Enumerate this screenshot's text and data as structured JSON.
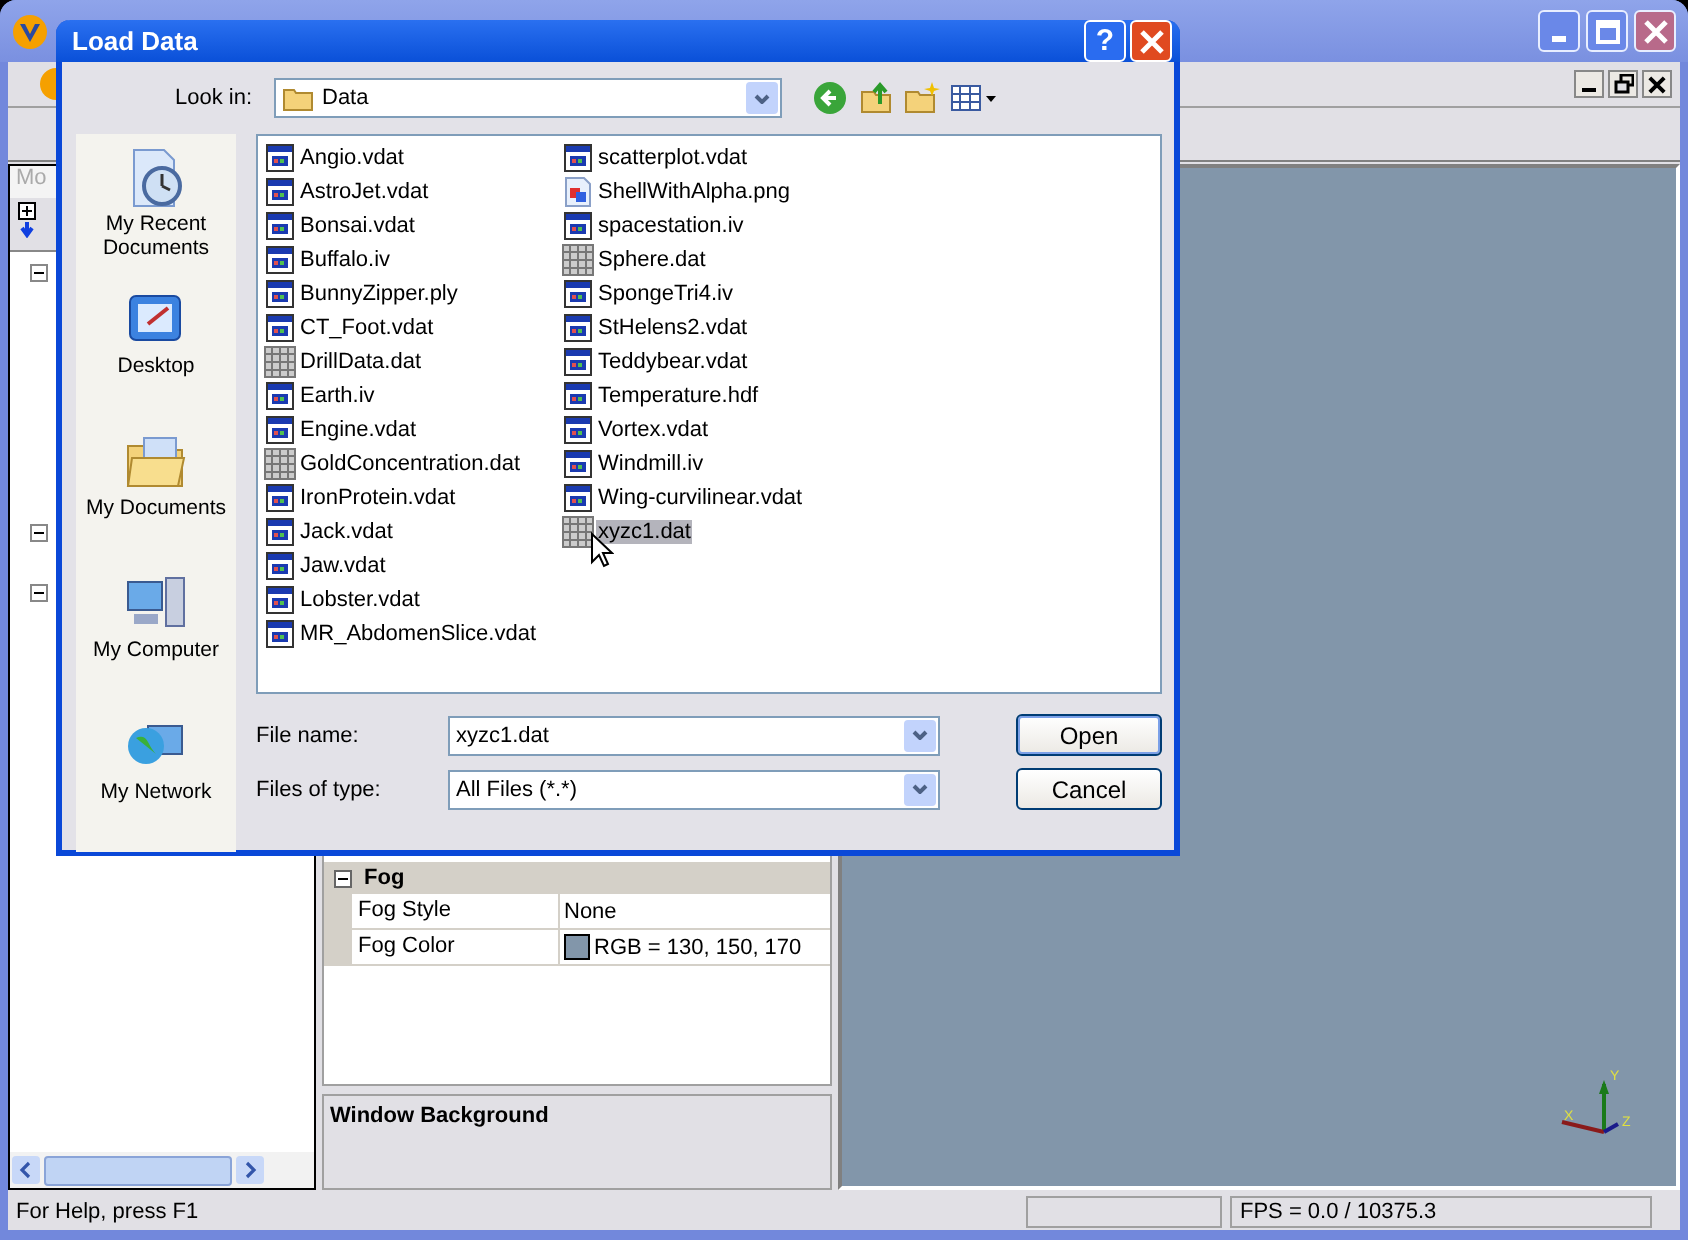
{
  "app": {
    "tree_header": "Mo"
  },
  "properties": {
    "section": {
      "title": "Fog",
      "expanded": true
    },
    "rows": [
      {
        "name": "Fog Style",
        "value": "None"
      },
      {
        "name": "Fog Color",
        "value": "RGB = 130, 150, 170",
        "color": "#8296aa"
      }
    ],
    "description_title": "Window Background"
  },
  "viewport": {
    "axes": [
      "X",
      "Y",
      "Z"
    ]
  },
  "status_bar": {
    "message": "For Help, press F1",
    "fps": "FPS = 0.0 / 10375.3"
  },
  "dialog": {
    "title": "Load Data",
    "help_button": "?",
    "look_in_label": "Look in:",
    "look_in": "Data",
    "places": [
      "My Recent Documents",
      "Desktop",
      "My Documents",
      "My Computer",
      "My Network"
    ],
    "files": [
      {
        "name": "Angio.vdat",
        "kind": "vdat",
        "selected": false
      },
      {
        "name": "AstroJet.vdat",
        "kind": "vdat",
        "selected": false
      },
      {
        "name": "Bonsai.vdat",
        "kind": "vdat",
        "selected": false
      },
      {
        "name": "Buffalo.iv",
        "kind": "vdat",
        "selected": false
      },
      {
        "name": "BunnyZipper.ply",
        "kind": "vdat",
        "selected": false
      },
      {
        "name": "CT_Foot.vdat",
        "kind": "vdat",
        "selected": false
      },
      {
        "name": "DrillData.dat",
        "kind": "grid",
        "selected": false
      },
      {
        "name": "Earth.iv",
        "kind": "vdat",
        "selected": false
      },
      {
        "name": "Engine.vdat",
        "kind": "vdat",
        "selected": false
      },
      {
        "name": "GoldConcentration.dat",
        "kind": "grid",
        "selected": false
      },
      {
        "name": "IronProtein.vdat",
        "kind": "vdat",
        "selected": false
      },
      {
        "name": "Jack.vdat",
        "kind": "vdat",
        "selected": false
      },
      {
        "name": "Jaw.vdat",
        "kind": "vdat",
        "selected": false
      },
      {
        "name": "Lobster.vdat",
        "kind": "vdat",
        "selected": false
      },
      {
        "name": "MR_AbdomenSlice.vdat",
        "kind": "vdat",
        "selected": false
      },
      {
        "name": "scatterplot.vdat",
        "kind": "vdat",
        "selected": false
      },
      {
        "name": "ShellWithAlpha.png",
        "kind": "image",
        "selected": false
      },
      {
        "name": "spacestation.iv",
        "kind": "vdat",
        "selected": false
      },
      {
        "name": "Sphere.dat",
        "kind": "grid",
        "selected": false
      },
      {
        "name": "SpongeTri4.iv",
        "kind": "vdat",
        "selected": false
      },
      {
        "name": "StHelens2.vdat",
        "kind": "vdat",
        "selected": false
      },
      {
        "name": "Teddybear.vdat",
        "kind": "vdat",
        "selected": false
      },
      {
        "name": "Temperature.hdf",
        "kind": "vdat",
        "selected": false
      },
      {
        "name": "Vortex.vdat",
        "kind": "vdat",
        "selected": false
      },
      {
        "name": "Windmill.iv",
        "kind": "vdat",
        "selected": false
      },
      {
        "name": "Wing-curvilinear.vdat",
        "kind": "vdat",
        "selected": false
      },
      {
        "name": "xyzc1.dat",
        "kind": "grid",
        "selected": true
      }
    ],
    "file_name_label": "File name:",
    "file_name": "xyzc1.dat",
    "file_type_label": "Files of type:",
    "file_type": "All Files (*.*)",
    "buttons": [
      "Open",
      "Cancel"
    ]
  }
}
